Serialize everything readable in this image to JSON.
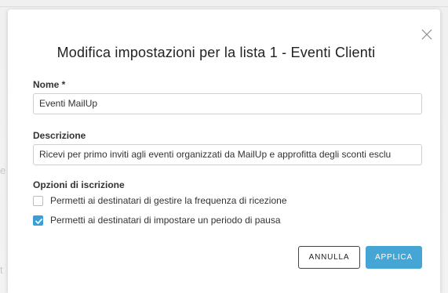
{
  "dialog": {
    "title": "Modifica impostazioni per la lista 1 - Eventi Clienti",
    "close_icon": "close-icon"
  },
  "form": {
    "name_label": "Nome *",
    "name_value": "Eventi MailUp",
    "description_label": "Descrizione",
    "description_value": "Ricevi per primo inviti agli eventi organizzati da MailUp e approfitta degli sconti esclu",
    "options_label": "Opzioni di iscrizione",
    "options": [
      {
        "label": "Permetti ai destinatari di gestire la frequenza di ricezione",
        "checked": false
      },
      {
        "label": "Permetti ai destinatari di impostare un periodo di pausa",
        "checked": true
      }
    ]
  },
  "buttons": {
    "cancel_label": "ANNULLA",
    "apply_label": "APPLICA"
  },
  "colors": {
    "accent": "#45a6d6",
    "checkbox_checked": "#3a9fd6",
    "text": "#333333"
  }
}
